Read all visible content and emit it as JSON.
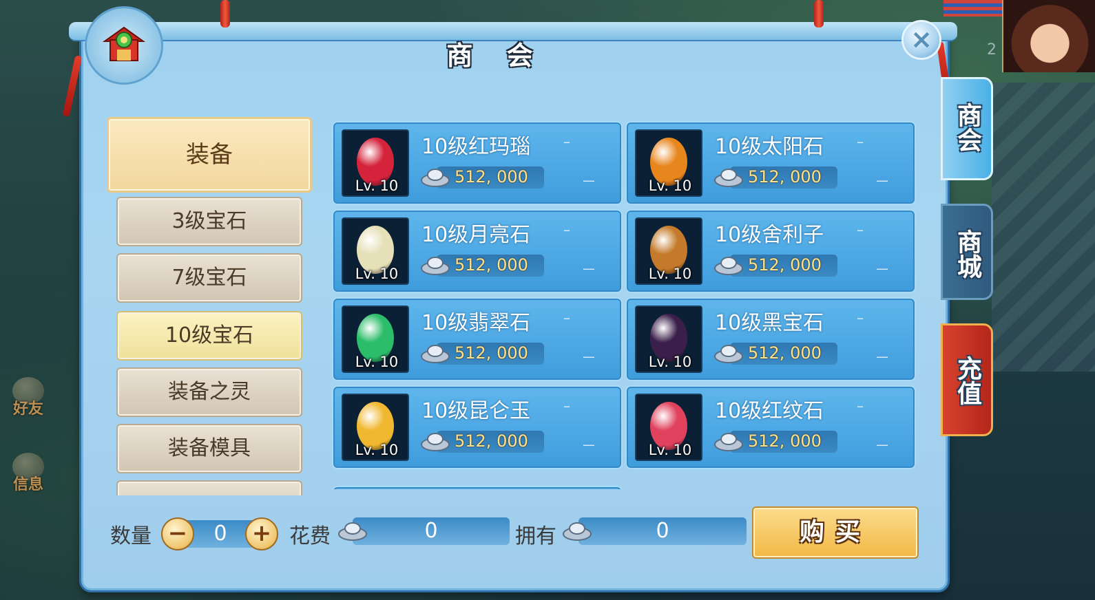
{
  "window": {
    "title": "商 会",
    "close_label": "×"
  },
  "side_tabs": [
    {
      "label": "商会",
      "active": true
    },
    {
      "label": "商城",
      "active": false
    },
    {
      "label": "充值",
      "active": false
    }
  ],
  "hud": {
    "friends_label": "好友",
    "messages_label": "信息",
    "portrait_number": "2"
  },
  "categories": {
    "main": "装备",
    "items": [
      {
        "label": "3级宝石",
        "active": false
      },
      {
        "label": "7级宝石",
        "active": false
      },
      {
        "label": "10级宝石",
        "active": true
      },
      {
        "label": "装备之灵",
        "active": false
      },
      {
        "label": "装备模具",
        "active": false
      }
    ]
  },
  "items": [
    {
      "name": "10级红玛瑙",
      "level": "Lv. 10",
      "price": "512, 000",
      "gem_color": "#d4233b",
      "dash1": "–",
      "dash2": "––"
    },
    {
      "name": "10级太阳石",
      "level": "Lv. 10",
      "price": "512, 000",
      "gem_color": "#e8861e",
      "dash1": "–",
      "dash2": "––"
    },
    {
      "name": "10级月亮石",
      "level": "Lv. 10",
      "price": "512, 000",
      "gem_color": "#e6e0b8",
      "dash1": "–",
      "dash2": "––"
    },
    {
      "name": "10级舍利子",
      "level": "Lv. 10",
      "price": "512, 000",
      "gem_color": "#c47a2a",
      "dash1": "–",
      "dash2": "––"
    },
    {
      "name": "10级翡翠石",
      "level": "Lv. 10",
      "price": "512, 000",
      "gem_color": "#2bbd69",
      "dash1": "–",
      "dash2": "––"
    },
    {
      "name": "10级黑宝石",
      "level": "Lv. 10",
      "price": "512, 000",
      "gem_color": "#3a1f4a",
      "dash1": "–",
      "dash2": "––"
    },
    {
      "name": "10级昆仑玉",
      "level": "Lv. 10",
      "price": "512, 000",
      "gem_color": "#f0b830",
      "dash1": "–",
      "dash2": "––"
    },
    {
      "name": "10级红纹石",
      "level": "Lv. 10",
      "price": "512, 000",
      "gem_color": "#e0425e",
      "dash1": "–",
      "dash2": "––"
    }
  ],
  "purchase": {
    "quantity_label": "数量",
    "quantity_value": "0",
    "minus_label": "−",
    "plus_label": "+",
    "cost_label": "花费",
    "cost_value": "0",
    "owned_label": "拥有",
    "owned_value": "0",
    "buy_label": "购买"
  },
  "colors": {
    "panel": "#a8d6f1",
    "card": "#4aa6e2",
    "accent_gold": "#f2b846",
    "price_text": "#ffe38a"
  }
}
